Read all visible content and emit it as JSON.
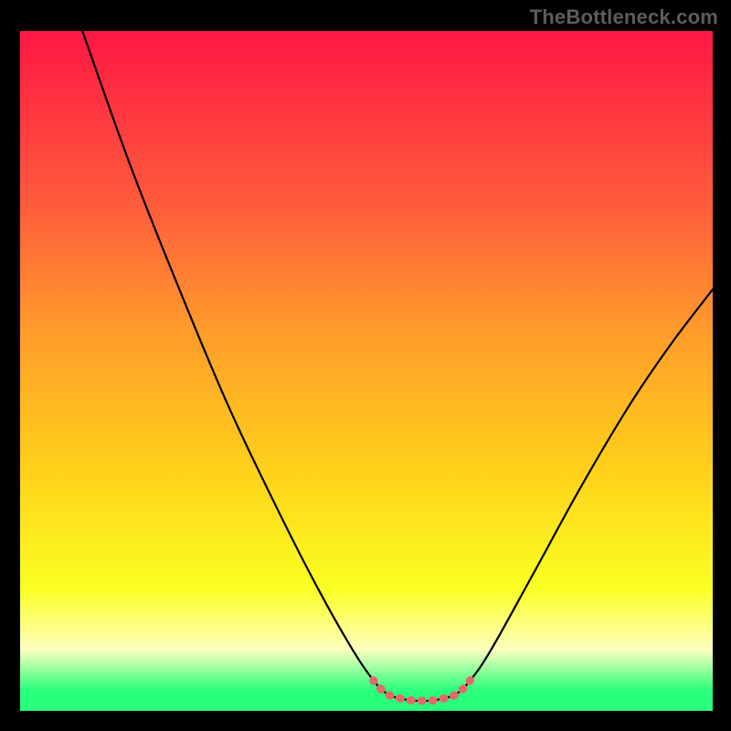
{
  "watermark": "TheBottleneck.com",
  "colors": {
    "background": "#000000",
    "gradient_top": "#ff1744",
    "gradient_mid1": "#ff5a3c",
    "gradient_mid2": "#ff9e2a",
    "gradient_mid3": "#ffd21a",
    "gradient_low": "#faff22",
    "gradient_pale": "#fdffbf",
    "gradient_green": "#28ff7b",
    "curve": "#000000",
    "marker": "#e46a6a"
  },
  "chart_data": {
    "type": "line",
    "title": "",
    "xlabel": "",
    "ylabel": "",
    "xlim": [
      0,
      100
    ],
    "ylim": [
      0,
      100
    ],
    "series": [
      {
        "name": "curve",
        "points": [
          {
            "x": 9.0,
            "y": 100.0
          },
          {
            "x": 16.0,
            "y": 80.0
          },
          {
            "x": 23.0,
            "y": 62.0
          },
          {
            "x": 30.0,
            "y": 45.0
          },
          {
            "x": 37.0,
            "y": 30.0
          },
          {
            "x": 43.0,
            "y": 18.0
          },
          {
            "x": 48.0,
            "y": 9.0
          },
          {
            "x": 51.0,
            "y": 4.5
          },
          {
            "x": 53.0,
            "y": 2.5
          },
          {
            "x": 55.0,
            "y": 1.8
          },
          {
            "x": 57.0,
            "y": 1.5
          },
          {
            "x": 59.0,
            "y": 1.5
          },
          {
            "x": 61.0,
            "y": 1.8
          },
          {
            "x": 63.0,
            "y": 2.5
          },
          {
            "x": 65.0,
            "y": 4.5
          },
          {
            "x": 68.0,
            "y": 9.0
          },
          {
            "x": 74.0,
            "y": 20.0
          },
          {
            "x": 81.0,
            "y": 33.0
          },
          {
            "x": 88.0,
            "y": 45.0
          },
          {
            "x": 94.0,
            "y": 54.0
          },
          {
            "x": 100.0,
            "y": 62.0
          }
        ]
      },
      {
        "name": "optimal-marker",
        "points": [
          {
            "x": 51.0,
            "y": 4.5
          },
          {
            "x": 52.0,
            "y": 3.3
          },
          {
            "x": 53.0,
            "y": 2.5
          },
          {
            "x": 54.0,
            "y": 2.0
          },
          {
            "x": 55.0,
            "y": 1.8
          },
          {
            "x": 56.0,
            "y": 1.6
          },
          {
            "x": 57.0,
            "y": 1.5
          },
          {
            "x": 58.0,
            "y": 1.5
          },
          {
            "x": 59.0,
            "y": 1.5
          },
          {
            "x": 60.0,
            "y": 1.6
          },
          {
            "x": 61.0,
            "y": 1.8
          },
          {
            "x": 62.0,
            "y": 2.0
          },
          {
            "x": 63.0,
            "y": 2.5
          },
          {
            "x": 64.0,
            "y": 3.3
          },
          {
            "x": 65.0,
            "y": 4.5
          }
        ]
      }
    ],
    "gradient_stops": [
      {
        "offset": 0.0,
        "key": "gradient_top"
      },
      {
        "offset": 0.25,
        "key": "gradient_mid1"
      },
      {
        "offset": 0.45,
        "key": "gradient_mid2"
      },
      {
        "offset": 0.65,
        "key": "gradient_mid3"
      },
      {
        "offset": 0.82,
        "key": "gradient_low"
      },
      {
        "offset": 0.91,
        "key": "gradient_pale"
      },
      {
        "offset": 0.97,
        "key": "gradient_green"
      },
      {
        "offset": 1.0,
        "key": "gradient_green"
      }
    ]
  }
}
